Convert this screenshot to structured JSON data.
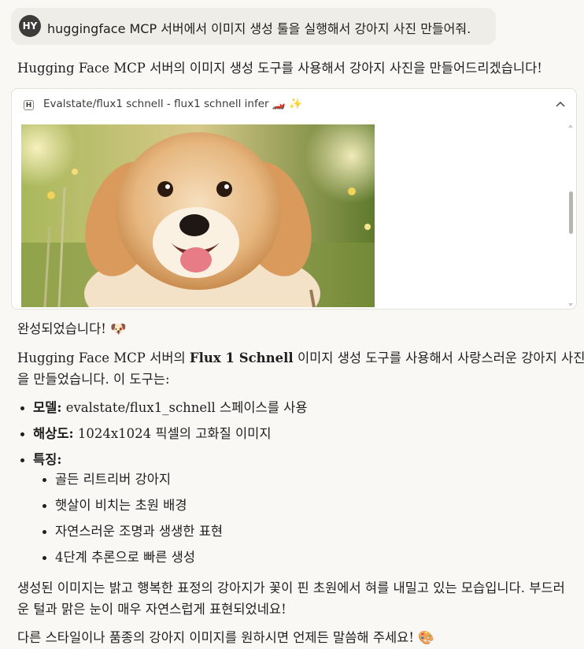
{
  "user_message": {
    "avatar_initials": "HY",
    "text": "huggingface MCP 서버에서 이미지 생성 툴을 실행해서 강아지 사진 만들어줘."
  },
  "assistant": {
    "intro": "Hugging Face MCP 서버의 이미지 생성 도구를 사용해서 강아지 사진을 만들어드리겠습니다!",
    "tool_call": {
      "icon_letter": "H",
      "title": "Evalstate/flux1 schnell - flux1 schnell infer",
      "title_emoji": "🏎️ ✨",
      "image_alt": "golden retriever puppy in a sunny meadow"
    },
    "done_text": "완성되었습니다! 🐶",
    "desc_line1_pre": "Hugging Face MCP 서버의 ",
    "desc_line1_bold": "Flux 1 Schnell",
    "desc_line1_post": " 이미지 생성 도구를 사용해서 사랑스러운 강아지 사진",
    "desc_line2": "을 만들었습니다. 이 도구는:",
    "features": [
      {
        "label": "모델:",
        "value": " evalstate/flux1_schnell 스페이스를 사용"
      },
      {
        "label": "해상도:",
        "value": " 1024x1024 픽셀의 고화질 이미지"
      },
      {
        "label": "특징:",
        "value": ""
      }
    ],
    "sub_features": [
      "골든 리트리버 강아지",
      "햇살이 비치는 초원 배경",
      "자연스러운 조명과 생생한 표현",
      "4단계 추론으로 빠른 생성"
    ],
    "summary_line1": "생성된 이미지는 밝고 행복한 표정의 강아지가 꽃이 핀 초원에서 혀를 내밀고 있는 모습입니다. 부드러",
    "summary_line2": "운 털과 맑은 눈이 매우 자연스럽게 표현되었네요!",
    "closing": "다른 스타일이나 품종의 강아지 이미지를 원하시면 언제든 말씀해 주세요! 🎨"
  },
  "colors": {
    "background": "#f9f8f5",
    "bubble": "#efede7",
    "avatar": "#3d3c39",
    "text": "#1f1e1d"
  }
}
